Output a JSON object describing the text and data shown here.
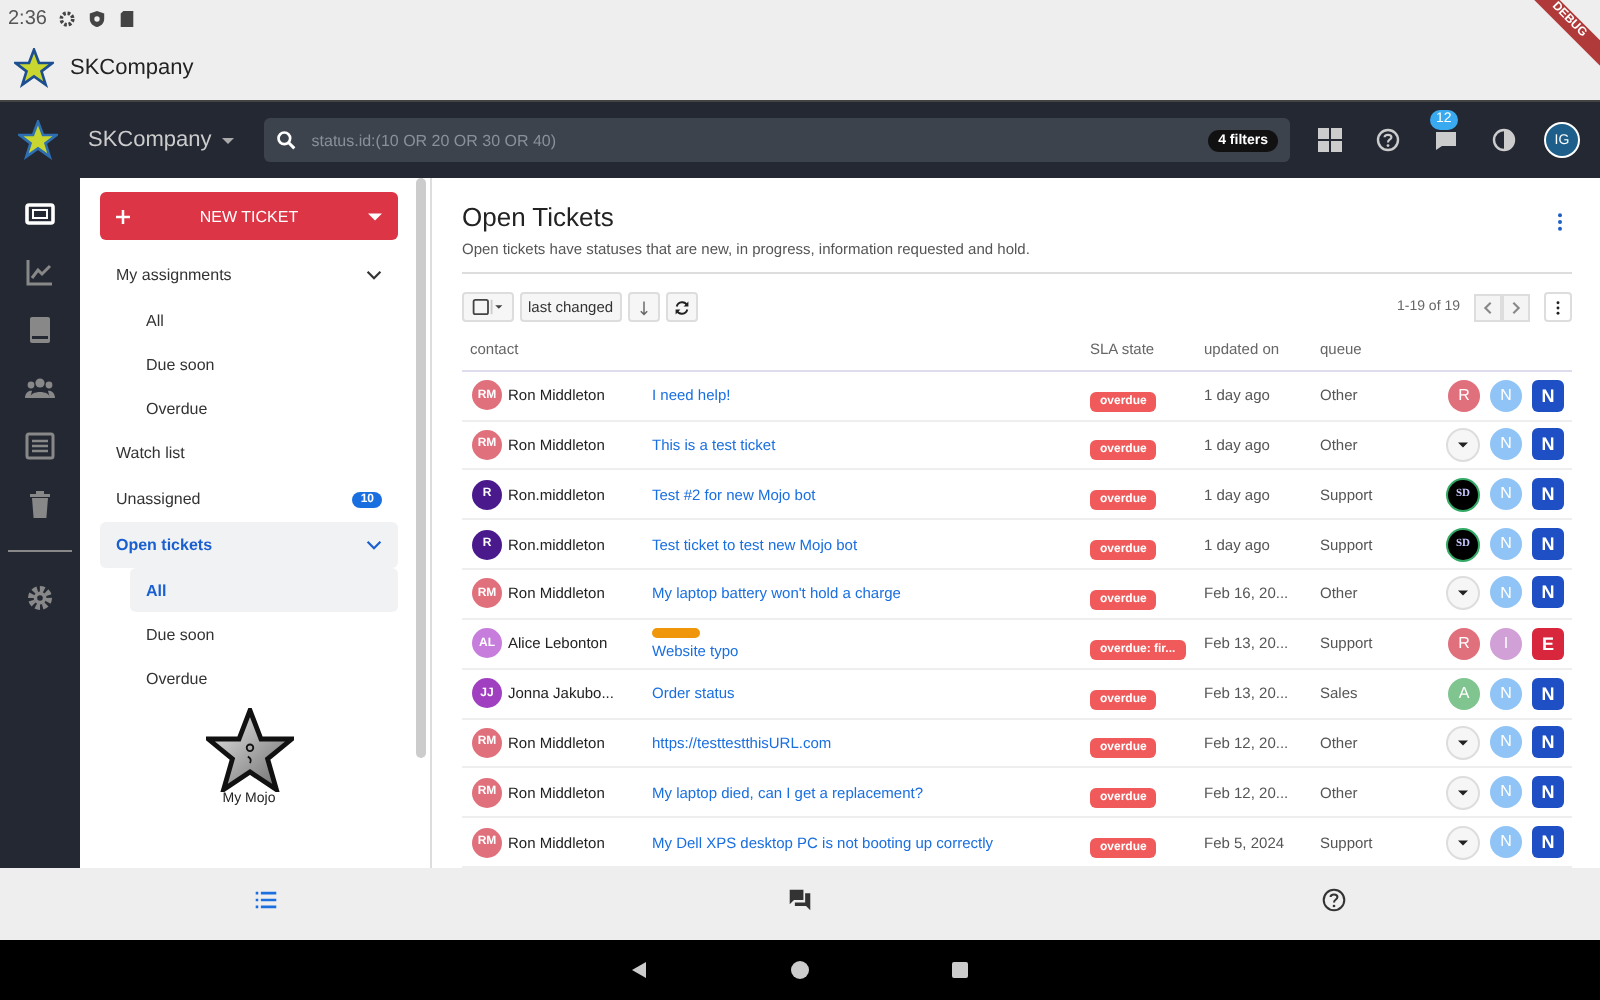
{
  "status_bar": {
    "time": "2:36"
  },
  "app_bar": {
    "title": "SKCompany"
  },
  "debug_banner": {
    "label": "DEBUG"
  },
  "toolbar": {
    "company": "SKCompany",
    "search": {
      "placeholder": "status.id:(10 OR 20 OR 30 OR 40)"
    },
    "filters": "4 filters",
    "notifications": "12",
    "user_initials": "IG"
  },
  "rail": [
    {
      "kind": "tickets",
      "selected": true
    },
    {
      "kind": "chart",
      "selected": false
    },
    {
      "kind": "book",
      "selected": false
    },
    {
      "kind": "people",
      "selected": false
    },
    {
      "kind": "list",
      "selected": false
    },
    {
      "kind": "trash",
      "selected": false
    },
    {
      "kind": "divider"
    },
    {
      "kind": "settings",
      "selected": false
    }
  ],
  "new_ticket": {
    "label": "NEW TICKET"
  },
  "nav": [
    {
      "label": "My assignments",
      "selected": false,
      "expanded": true,
      "children": [
        {
          "label": "All",
          "selected": false
        },
        {
          "label": "Due soon",
          "selected": false
        },
        {
          "label": "Overdue",
          "selected": false
        }
      ]
    },
    {
      "label": "Watch list",
      "selected": false
    },
    {
      "label": "Unassigned",
      "selected": false,
      "badge": "10"
    },
    {
      "label": "Open tickets",
      "selected": true,
      "expanded": true,
      "children": [
        {
          "label": "All",
          "selected": true
        },
        {
          "label": "Due soon",
          "selected": false
        },
        {
          "label": "Overdue",
          "selected": false
        }
      ]
    }
  ],
  "mojo": {
    "label": "My Mojo"
  },
  "page": {
    "title": "Open Tickets",
    "description": "Open tickets have statuses that are new, in progress, information requested and hold."
  },
  "list_toolbar": {
    "sort": "last changed",
    "range": "1-19 of 19"
  },
  "table": {
    "columns": [
      "contact",
      "SLA state",
      "updated on",
      "queue"
    ],
    "rows": [
      {
        "avatar": {
          "initials": "RM",
          "color": "#e0707c"
        },
        "contact": "Ron Middleton",
        "subject": "I need help!",
        "sla": "overdue",
        "updated": "1 day ago",
        "queue": "Other",
        "assignee": {
          "kind": "letter",
          "text": "R",
          "color": "#e0707c"
        },
        "status": {
          "text": "N",
          "color": "#90c4f6"
        },
        "priority": {
          "text": "N",
          "color": "#1f4fc4"
        }
      },
      {
        "avatar": {
          "initials": "RM",
          "color": "#e0707c"
        },
        "contact": "Ron Middleton",
        "subject": "This is a test ticket",
        "sla": "overdue",
        "updated": "1 day ago",
        "queue": "Other",
        "assignee": {
          "kind": "empty"
        },
        "status": {
          "text": "N",
          "color": "#90c4f6"
        },
        "priority": {
          "text": "N",
          "color": "#1f4fc4"
        }
      },
      {
        "avatar": {
          "initials": "R",
          "color": "#4a1a8c"
        },
        "contact": "Ron.middleton",
        "subject": "Test #2 for new Mojo bot",
        "sla": "overdue",
        "updated": "1 day ago",
        "queue": "Support",
        "assignee": {
          "kind": "logo",
          "text": "SD"
        },
        "status": {
          "text": "N",
          "color": "#90c4f6"
        },
        "priority": {
          "text": "N",
          "color": "#1f4fc4"
        }
      },
      {
        "avatar": {
          "initials": "R",
          "color": "#4a1a8c"
        },
        "contact": "Ron.middleton",
        "subject": "Test ticket to test new Mojo bot",
        "sla": "overdue",
        "updated": "1 day ago",
        "queue": "Support",
        "assignee": {
          "kind": "logo",
          "text": "SD"
        },
        "status": {
          "text": "N",
          "color": "#90c4f6"
        },
        "priority": {
          "text": "N",
          "color": "#1f4fc4"
        }
      },
      {
        "avatar": {
          "initials": "RM",
          "color": "#e0707c"
        },
        "contact": "Ron Middleton",
        "subject": "My laptop battery won't hold a charge",
        "sla": "overdue",
        "updated": "Feb 16, 20...",
        "queue": "Other",
        "assignee": {
          "kind": "empty"
        },
        "status": {
          "text": "N",
          "color": "#90c4f6"
        },
        "priority": {
          "text": "N",
          "color": "#1f4fc4"
        }
      },
      {
        "avatar": {
          "initials": "AL",
          "color": "#c77ddb"
        },
        "contact": "Alice Lebonton",
        "tag": {
          "color": "#f0960a"
        },
        "subject": "Website typo",
        "sla": "overdue: fir...",
        "updated": "Feb 13, 20...",
        "queue": "Support",
        "assignee": {
          "kind": "letter",
          "text": "R",
          "color": "#e0707c"
        },
        "status": {
          "text": "I",
          "color": "#d0a0d6"
        },
        "priority": {
          "text": "E",
          "color": "#d8263c"
        }
      },
      {
        "avatar": {
          "initials": "JJ",
          "color": "#a040c0"
        },
        "contact": "Jonna Jakubo...",
        "subject": "Order status",
        "sla": "overdue",
        "updated": "Feb 13, 20...",
        "queue": "Sales",
        "assignee": {
          "kind": "letter",
          "text": "A",
          "color": "#80c490"
        },
        "status": {
          "text": "N",
          "color": "#90c4f6"
        },
        "priority": {
          "text": "N",
          "color": "#1f4fc4"
        }
      },
      {
        "avatar": {
          "initials": "RM",
          "color": "#e0707c"
        },
        "contact": "Ron Middleton",
        "subject": "https://testtestthisURL.com",
        "sla": "overdue",
        "updated": "Feb 12, 20...",
        "queue": "Other",
        "assignee": {
          "kind": "empty"
        },
        "status": {
          "text": "N",
          "color": "#90c4f6"
        },
        "priority": {
          "text": "N",
          "color": "#1f4fc4"
        }
      },
      {
        "avatar": {
          "initials": "RM",
          "color": "#e0707c"
        },
        "contact": "Ron Middleton",
        "subject": "My laptop died, can I get a replacement?",
        "sla": "overdue",
        "updated": "Feb 12, 20...",
        "queue": "Other",
        "assignee": {
          "kind": "empty"
        },
        "status": {
          "text": "N",
          "color": "#90c4f6"
        },
        "priority": {
          "text": "N",
          "color": "#1f4fc4"
        }
      },
      {
        "avatar": {
          "initials": "RM",
          "color": "#e0707c"
        },
        "contact": "Ron Middleton",
        "subject": "My Dell XPS desktop PC is not booting up correctly",
        "sla": "overdue",
        "updated": "Feb 5, 2024",
        "queue": "Support",
        "assignee": {
          "kind": "empty"
        },
        "status": {
          "text": "N",
          "color": "#90c4f6"
        },
        "priority": {
          "text": "N",
          "color": "#1f4fc4"
        }
      }
    ]
  },
  "bottom_nav": [
    {
      "kind": "list",
      "selected": true
    },
    {
      "kind": "chat",
      "selected": false
    },
    {
      "kind": "help",
      "selected": false
    }
  ]
}
